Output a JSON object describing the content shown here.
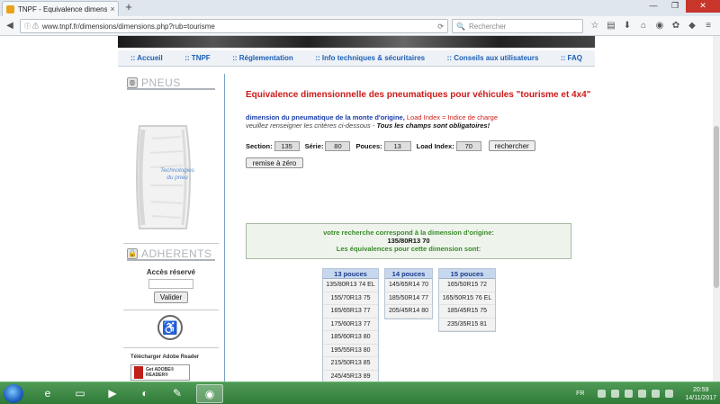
{
  "browser": {
    "tab_title": "TNPF - Equivalence dimensionne",
    "tab_close": "×",
    "new_tab": "+",
    "url": "www.tnpf.fr/dimensions/dimensions.php?rub=tourisme",
    "search_placeholder": "Rechercher",
    "win_min": "—",
    "win_max": "❐",
    "win_close": "✕"
  },
  "menu": [
    ":: Accueil",
    ":: TNPF",
    ":: Réglementation",
    ":: Info techniques & sécuritaires",
    ":: Conseils aux utilisateurs",
    ":: FAQ"
  ],
  "sidebar": {
    "pneus_title": "PNEUS",
    "tyre_text_1": "Technologies",
    "tyre_text_2": "du pneu",
    "adherents_title": "ADHERENTS",
    "acces_label": "Accès réservé",
    "valider": "Valider",
    "adobe_label": "Télécharger Adobe Reader",
    "adobe_btn": "Get ADOBE® READER®"
  },
  "main": {
    "title": "Equivalence dimensionnelle des pneumatiques pour véhicules \"tourisme et 4x4\"",
    "desc_blue": "dimension du pneumatique de la monte d'origine, ",
    "desc_red": "Load Index = Indice de charge",
    "desc2_plain": "veuillez renseigner les critères ci-dessous - ",
    "desc2_bold": "Tous les champs sont obligatoires!",
    "form": {
      "section_label": "Section:",
      "section_value": "135",
      "serie_label": "Série:",
      "serie_value": "80",
      "pouces_label": "Pouces:",
      "pouces_value": "13",
      "load_label": "Load Index:",
      "load_value": "70",
      "search_btn": "rechercher",
      "reset_btn": "remise à zéro"
    },
    "result": {
      "line1": "votre recherche correspond à la dimension d'origine:",
      "line2": "135/80R13 70",
      "line3": "Les équivalences pour cette dimension sont:"
    },
    "tables": [
      {
        "header": "13 pouces",
        "rows": [
          "135/80R13 74 EL",
          "155/70R13 75",
          "165/65R13 77",
          "175/60R13 77",
          "185/60R13 80",
          "195/55R13 80",
          "215/50R13 85",
          "245/45R13 89"
        ]
      },
      {
        "header": "14 pouces",
        "rows": [
          "145/65R14 70",
          "185/50R14 77",
          "205/45R14 80"
        ]
      },
      {
        "header": "15 pouces",
        "rows": [
          "165/50R15 72",
          "165/50R15 76 EL",
          "185/45R15 75",
          "235/35R15 81"
        ]
      }
    ]
  },
  "taskbar": {
    "lang": "FR",
    "time": "20:59",
    "date": "14/11/2017"
  }
}
